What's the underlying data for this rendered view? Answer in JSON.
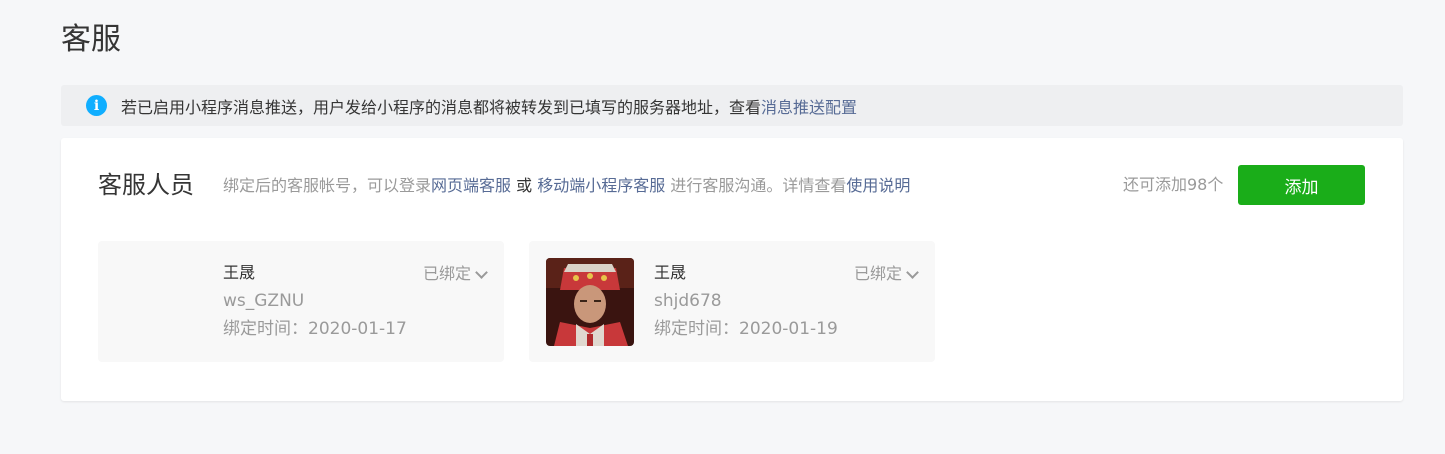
{
  "page": {
    "title": "客服"
  },
  "notice": {
    "icon": "info-icon",
    "icon_glyph": "i",
    "text": "若已启用小程序消息推送，用户发给小程序的消息都将被转发到已填写的服务器地址，查看 ",
    "link_text": "消息推送配置"
  },
  "section": {
    "title": "客服人员",
    "desc_part1": "绑定后的客服帐号，可以登录",
    "link_web": "网页端客服",
    "desc_or": " 或 ",
    "link_mobile": "移动端小程序客服",
    "desc_part2": " 进行客服沟通。详情查看",
    "link_help": "使用说明",
    "remain_text": "还可添加98个",
    "add_button": "添加"
  },
  "agents": [
    {
      "name": "王晟",
      "account": "ws_GZNU",
      "bind_time": "绑定时间：2020-01-17",
      "status": "已绑定",
      "has_avatar": false
    },
    {
      "name": "王晟",
      "account": "shjd678",
      "bind_time": "绑定时间：2020-01-19",
      "status": "已绑定",
      "has_avatar": true
    }
  ],
  "colors": {
    "accent_green": "#1aad19",
    "link_blue": "#576b95",
    "info_blue": "#10aeff"
  }
}
